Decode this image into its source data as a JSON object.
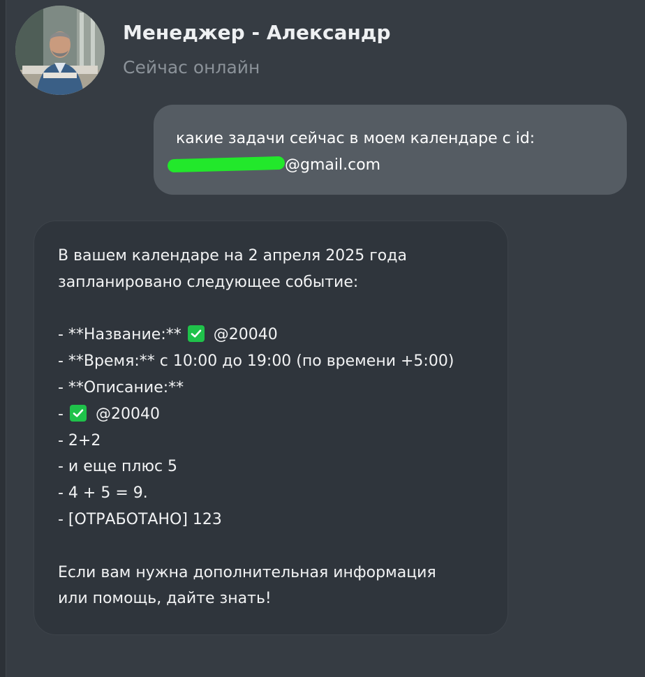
{
  "header": {
    "name": "Менеджер - Александр",
    "status": "Сейчас онлайн",
    "avatar": "person-avatar"
  },
  "user_message": {
    "line1": "какие задачи сейчас в моем календаре с id:",
    "email_suffix": "@gmail.com"
  },
  "bot_message": {
    "intro1": "В вашем календаре на 2 апреля 2025 года",
    "intro2": "запланировано следующее событие:",
    "item_name_prefix": "- **Название:**",
    "item_name_value": "@20040",
    "item_time": "- **Время:** с 10:00 до 19:00 (по времени +5:00)",
    "item_desc": "- **Описание:**",
    "desc_prefix": "-",
    "desc_value": "@20040",
    "line_a": "- 2+2",
    "line_b": "- и еще плюс 5",
    "line_c": "- 4 + 5 = 9.",
    "line_d": "- [ОТРАБОТАНО] 123",
    "outro1": "Если вам нужна дополнительная информация",
    "outro2": "или помощь, дайте знать!"
  },
  "colors": {
    "background": "#363c43",
    "user_bubble": "#555c63",
    "bot_bubble": "#2f353c",
    "redaction": "#22e82b",
    "checkmark": "#1fc24a",
    "status_text": "#8b9299"
  },
  "icons": {
    "checkmark": "white-heavy-check-mark-icon"
  }
}
